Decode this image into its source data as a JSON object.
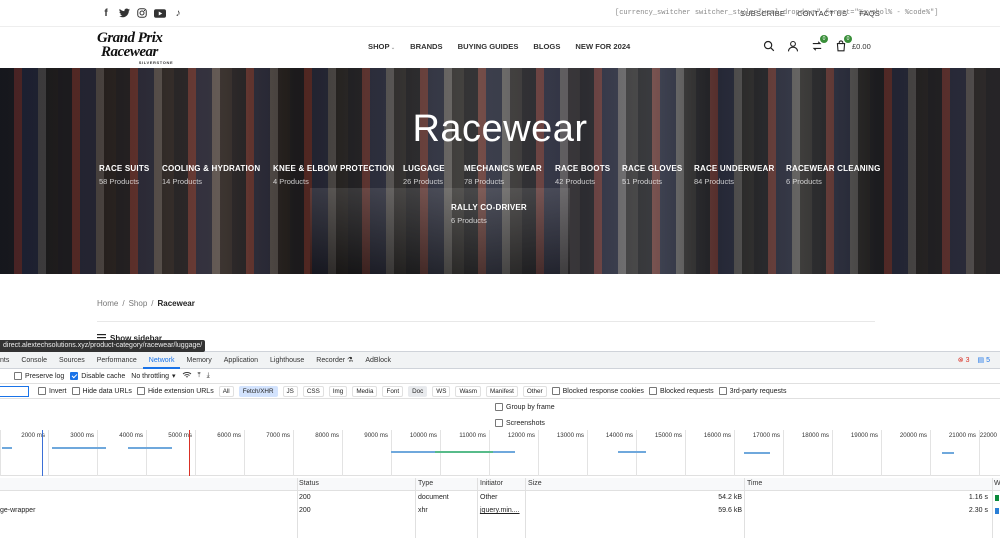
{
  "topbar": {
    "social": [
      {
        "icon": "facebook-icon",
        "glyph": "f"
      },
      {
        "icon": "twitter-icon",
        "glyph": "t"
      },
      {
        "icon": "instagram-icon",
        "glyph": "◎"
      },
      {
        "icon": "youtube-icon",
        "glyph": "▶"
      },
      {
        "icon": "tiktok-icon",
        "glyph": "♪"
      }
    ],
    "links": [
      "SUBSCRIBE",
      "CONTACT US",
      "FAQS"
    ],
    "shortcode": "[currency_switcher switcher_style=\"wcml-dropdown\" format=\"%symbol% - %code%\"]"
  },
  "header": {
    "logo_line1": "Grand Prix",
    "logo_line2": "Racewear",
    "logo_sub": "SILVERSTONE",
    "nav": [
      "SHOP",
      "BRANDS",
      "BUYING GUIDES",
      "BLOGS",
      "NEW FOR 2024"
    ],
    "compare_count": "0",
    "cart_count": "0",
    "cart_total": "£0.00"
  },
  "hero": {
    "title": "Racewear",
    "categories": [
      {
        "name": "RACE SUITS",
        "count": "58 Products"
      },
      {
        "name": "COOLING & HYDRATION",
        "count": "14 Products"
      },
      {
        "name": "KNEE & ELBOW PROTECTION",
        "count": "4 Products"
      },
      {
        "name": "LUGGAGE",
        "count": "26 Products"
      },
      {
        "name": "MECHANICS WEAR",
        "count": "78 Products"
      },
      {
        "name": "RACE BOOTS",
        "count": "42 Products"
      },
      {
        "name": "RACE GLOVES",
        "count": "51 Products"
      },
      {
        "name": "RACE UNDERWEAR",
        "count": "84 Products"
      },
      {
        "name": "RACEWEAR CLEANING",
        "count": "6 Products"
      },
      {
        "name": "RALLY CO-DRIVER",
        "count": "6 Products"
      }
    ]
  },
  "breadcrumb": {
    "home": "Home",
    "sep": "/",
    "shop": "Shop",
    "current": "Racewear"
  },
  "sidebar_toggle": "Show sidebar",
  "status_url": "direct.alextechsolutions.xyz/product-category/racewear/luggage/",
  "devtools": {
    "tabs": [
      "nts",
      "Console",
      "Sources",
      "Performance",
      "Network",
      "Memory",
      "Application",
      "Lighthouse",
      "Recorder",
      "AdBlock"
    ],
    "active_tab": "Network",
    "error_count": "3",
    "message_count": "5",
    "toolbar": {
      "preserve_log": "Preserve log",
      "disable_cache": "Disable cache",
      "throttling": "No throttling"
    },
    "filters": {
      "invert": "Invert",
      "hide_data_urls": "Hide data URLs",
      "hide_extension_urls": "Hide extension URLs",
      "types": [
        "All",
        "Fetch/XHR",
        "JS",
        "CSS",
        "Img",
        "Media",
        "Font",
        "Doc",
        "WS",
        "Wasm",
        "Manifest",
        "Other"
      ],
      "blocked_cookies": "Blocked response cookies",
      "blocked_requests": "Blocked requests",
      "third_party": "3rd-party requests"
    },
    "group_by_frame": "Group by frame",
    "screenshots": "Screenshots",
    "timeline_ticks": [
      "2000 ms",
      "3000 ms",
      "4000 ms",
      "5000 ms",
      "6000 ms",
      "7000 ms",
      "8000 ms",
      "9000 ms",
      "10000 ms",
      "11000 ms",
      "12000 ms",
      "13000 ms",
      "14000 ms",
      "15000 ms",
      "16000 ms",
      "17000 ms",
      "18000 ms",
      "19000 ms",
      "20000 ms",
      "21000 ms",
      "22000"
    ],
    "columns": [
      "Status",
      "Type",
      "Initiator",
      "Size",
      "Time",
      "W"
    ],
    "rows": [
      {
        "name": "",
        "status": "200",
        "type": "document",
        "initiator": "Other",
        "size": "54.2 kB",
        "time": "1.16 s"
      },
      {
        "name": "ge-wrapper",
        "status": "200",
        "type": "xhr",
        "initiator": "jquery.min....",
        "size": "59.6 kB",
        "time": "2.30 s"
      }
    ]
  }
}
